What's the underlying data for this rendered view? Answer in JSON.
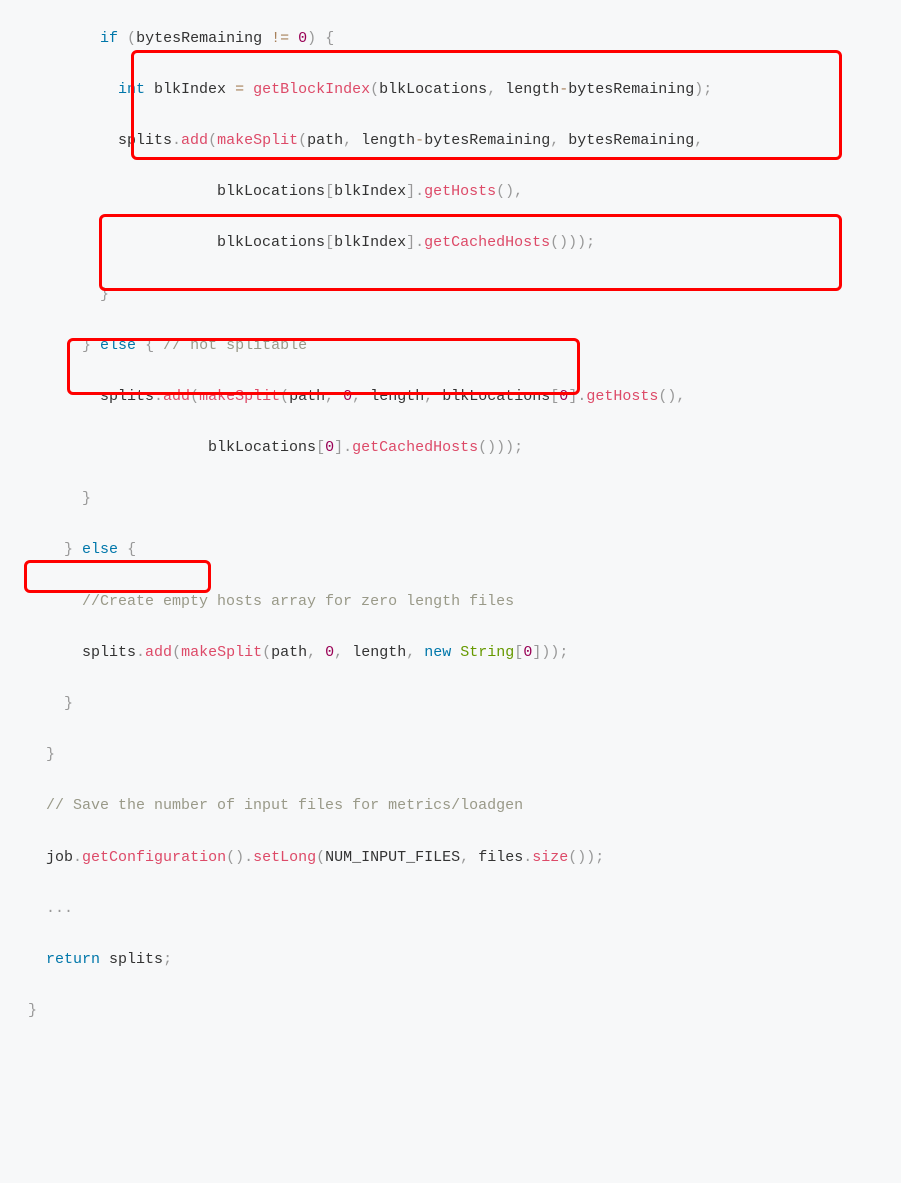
{
  "code": {
    "l1": {
      "indent": "        ",
      "kw_if": "if",
      "sp1": " ",
      "p1": "(",
      "id1": "bytesRemaining",
      "sp2": " ",
      "op1": "!=",
      "sp3": " ",
      "num1": "0",
      "p2": ")",
      "sp4": " ",
      "p3": "{"
    },
    "l2": {
      "indent": "          ",
      "type_int": "int",
      "sp1": " ",
      "id1": "blkIndex",
      "sp2": " ",
      "op_eq": "=",
      "sp3": " ",
      "fn": "getBlockIndex",
      "p1": "(",
      "id2": "blkLocations",
      "p2": ",",
      "sp4": " ",
      "id3": "length",
      "op_minus": "-",
      "id4": "bytesRemaining",
      "p3": ");"
    },
    "l3": {
      "indent": "          ",
      "id1": "splits",
      "p1": ".",
      "fn_add": "add",
      "p2": "(",
      "fn_ms": "makeSplit",
      "p3": "(",
      "id2": "path",
      "p4": ",",
      "sp1": " ",
      "id3": "length",
      "op_minus": "-",
      "id4": "bytesRemaining",
      "p5": ",",
      "sp2": " ",
      "id5": "bytesRemaining",
      "p6": ","
    },
    "l4": {
      "indent": "                     ",
      "id1": "blkLocations",
      "p1": "[",
      "id2": "blkIndex",
      "p2": "].",
      "fn": "getHosts",
      "p3": "(),"
    },
    "l5": {
      "indent": "                     ",
      "id1": "blkLocations",
      "p1": "[",
      "id2": "blkIndex",
      "p2": "].",
      "fn": "getCachedHosts",
      "p3": "()));"
    },
    "l6": {
      "indent": "        ",
      "p1": "}"
    },
    "l7": {
      "indent": "      ",
      "p1": "}",
      "sp1": " ",
      "kw_else": "else",
      "sp2": " ",
      "p2": "{",
      "sp3": " ",
      "comment": "// not splitable"
    },
    "l8": {
      "indent": "        ",
      "id1": "splits",
      "p1": ".",
      "fn_add": "add",
      "p2": "(",
      "fn_ms": "makeSplit",
      "p3": "(",
      "id2": "path",
      "p4": ",",
      "sp1": " ",
      "num0": "0",
      "p5": ",",
      "sp2": " ",
      "id3": "length",
      "p6": ",",
      "sp3": " ",
      "id4": "blkLocations",
      "p7": "[",
      "num0b": "0",
      "p8": "].",
      "fn_gh": "getHosts",
      "p9": "(),"
    },
    "l9": {
      "indent": "                    ",
      "id1": "blkLocations",
      "p1": "[",
      "num0": "0",
      "p2": "].",
      "fn": "getCachedHosts",
      "p3": "()));"
    },
    "l10": {
      "indent": "      ",
      "p1": "}"
    },
    "l11": {
      "indent": "    ",
      "p1": "}",
      "sp1": " ",
      "kw_else": "else",
      "sp2": " ",
      "p2": "{",
      "sp3": " "
    },
    "l12": {
      "indent": "      ",
      "comment": "//Create empty hosts array for zero length files"
    },
    "l13": {
      "indent": "      ",
      "id1": "splits",
      "p1": ".",
      "fn_add": "add",
      "p2": "(",
      "fn_ms": "makeSplit",
      "p3": "(",
      "id2": "path",
      "p4": ",",
      "sp1": " ",
      "num0": "0",
      "p5": ",",
      "sp2": " ",
      "id3": "length",
      "p6": ",",
      "sp3": " ",
      "kw_new": "new",
      "sp4": " ",
      "type_str": "String",
      "p7": "[",
      "num0b": "0",
      "p8": "]));"
    },
    "l14": {
      "indent": "    ",
      "p1": "}"
    },
    "l15": {
      "indent": "  ",
      "p1": "}"
    },
    "l16": {
      "indent": "  ",
      "comment": "// Save the number of input files for metrics/loadgen"
    },
    "l17": {
      "indent": "  ",
      "id1": "job",
      "p1": ".",
      "fn1": "getConfiguration",
      "p2": "().",
      "fn2": "setLong",
      "p3": "(",
      "id2": "NUM_INPUT_FILES",
      "p4": ",",
      "sp1": " ",
      "id3": "files",
      "p5": ".",
      "fn3": "size",
      "p6": "());"
    },
    "l18": {
      "indent": "  ",
      "p1": "..."
    },
    "l19": {
      "indent": "  ",
      "kw_return": "return",
      "sp1": " ",
      "id1": "splits",
      "p1": ";"
    },
    "l20": {
      "indent": "",
      "p1": "}"
    }
  }
}
